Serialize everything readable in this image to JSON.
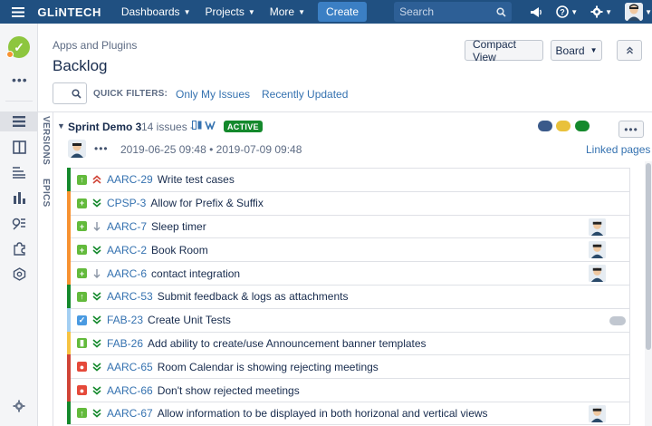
{
  "topnav": {
    "logo": "GLiNTECH",
    "items": [
      {
        "label": "Dashboards"
      },
      {
        "label": "Projects"
      },
      {
        "label": "More"
      }
    ],
    "create_label": "Create",
    "search_placeholder": "Search"
  },
  "header": {
    "breadcrumb": "Apps and Plugins",
    "title": "Backlog",
    "compact_view_label": "Compact View",
    "board_label": "Board"
  },
  "filters": {
    "label": "QUICK FILTERS:",
    "only_my_issues": "Only My Issues",
    "recently_updated": "Recently Updated"
  },
  "vertical_tabs": {
    "versions": "VERSIONS",
    "epics": "EPICS"
  },
  "sprint": {
    "name": "Sprint Demo 3",
    "issue_count": "14 issues",
    "count_separator": "-",
    "status": "ACTIVE",
    "more_label": "•••",
    "dots_label": "•••",
    "start_date": "2019-06-25 09:48",
    "date_separator": "•",
    "end_date": "2019-07-09 09:48",
    "linked_pages": "Linked pages",
    "status_pill_colors": [
      "#3b5a8a",
      "#e9c13b",
      "#14892c"
    ]
  },
  "issues": [
    {
      "key": "AARC-29",
      "summary": "Write test cases",
      "type": "story",
      "priority": "highest",
      "epic_color": "#14892c",
      "assignee": false,
      "toggle": false
    },
    {
      "key": "CPSP-3",
      "summary": "Allow for Prefix & Suffix",
      "type": "new-feature",
      "priority": "lowest",
      "epic_color": "#f79232",
      "assignee": false,
      "toggle": false
    },
    {
      "key": "AARC-7",
      "summary": "Sleep timer",
      "type": "new-feature",
      "priority": "low",
      "epic_color": "#f79232",
      "assignee": true,
      "toggle": false
    },
    {
      "key": "AARC-2",
      "summary": "Book Room",
      "type": "new-feature",
      "priority": "lowest",
      "epic_color": "#f79232",
      "assignee": true,
      "toggle": false
    },
    {
      "key": "AARC-6",
      "summary": "contact integration",
      "type": "new-feature",
      "priority": "low",
      "epic_color": "#f79232",
      "assignee": true,
      "toggle": false
    },
    {
      "key": "AARC-53",
      "summary": "Submit feedback & logs as attachments",
      "type": "story",
      "priority": "lowest",
      "epic_color": "#14892c",
      "assignee": false,
      "toggle": false
    },
    {
      "key": "FAB-23",
      "summary": "Create Unit Tests",
      "type": "task",
      "priority": "lowest",
      "epic_color": "#a4cff2",
      "assignee": false,
      "toggle": true
    },
    {
      "key": "FAB-26",
      "summary": "Add ability to create/use Announcement banner templates",
      "type": "story-bookmark",
      "priority": "lowest",
      "epic_color": "#f6c342",
      "assignee": false,
      "toggle": false
    },
    {
      "key": "AARC-65",
      "summary": "Room Calendar is showing rejecting meetings",
      "type": "bug",
      "priority": "lowest",
      "epic_color": "#d04437",
      "assignee": false,
      "toggle": false
    },
    {
      "key": "AARC-66",
      "summary": "Don't show rejected meetings",
      "type": "bug",
      "priority": "lowest",
      "epic_color": "#d04437",
      "assignee": false,
      "toggle": false
    },
    {
      "key": "AARC-67",
      "summary": "Allow information to be displayed in both horizonal and vertical views",
      "type": "story",
      "priority": "lowest",
      "epic_color": "#14892c",
      "assignee": true,
      "toggle": false
    }
  ],
  "colors": {
    "nav_bg": "#205081",
    "link": "#3572b0",
    "active_badge": "#14892c"
  }
}
